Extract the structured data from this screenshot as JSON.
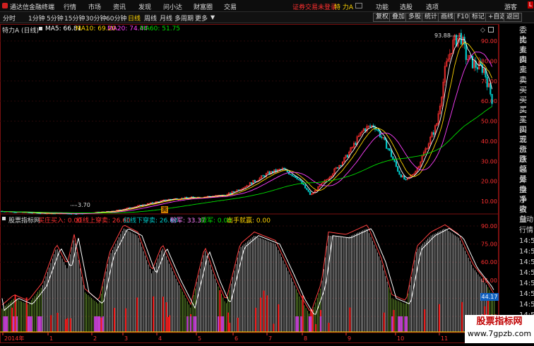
{
  "titlebar": {
    "app_title": "通达信金融终端",
    "menus": [
      "行情",
      "市场",
      "资讯",
      "发现",
      "问小达",
      "财富圈",
      "交易"
    ],
    "login_warning": "证券交易未登录",
    "stock_name": "特 力A",
    "right_menus": [
      "功能",
      "选股",
      "选项",
      "游客"
    ]
  },
  "toolbar": {
    "periods": [
      "分时",
      "1分钟",
      "5分钟",
      "15分钟",
      "30分钟",
      "60分钟",
      "日线",
      "周线",
      "月线",
      "多周期",
      "更多"
    ],
    "active_period": "日线",
    "buttons": [
      "复权",
      "叠加",
      "多股",
      "统计",
      "画线",
      "F10",
      "标记",
      "+自选",
      "返回"
    ]
  },
  "main_chart": {
    "stock_label": "特力A (日线)",
    "ma5": "MA5: 66.81",
    "ma10": "MA10: 69.20",
    "ma20": "MA20: 74.44",
    "ma60": "MA60: 51.75",
    "high_label": "93.88",
    "low_label": "3.70",
    "y_ticks": [
      "90.00",
      "80.00",
      "70.00",
      "60.00",
      "50.00",
      "40.00",
      "30.00",
      "20.00",
      "10.00"
    ],
    "marker_char": "寅",
    "colors": {
      "up": "#ff3030",
      "down": "#00c8c8",
      "ma5": "#ffffff",
      "ma10": "#ffd400",
      "ma20": "#ff40ff",
      "ma60": "#00e000"
    }
  },
  "indicator": {
    "name": "股票指标网",
    "label1": "买庄买入: 0.00",
    "label2": "红线上穿卖: 26.60",
    "label3": "红线下穿卖: 26.60",
    "label4": "粉军: 33.37",
    "label5": "绿军: 0.00",
    "label6": "出手就赢: 0.00",
    "y_ticks": [
      "90.00",
      "75.00",
      "60.00",
      "45.00",
      "30.00",
      "15.00"
    ],
    "current_value": "44.17"
  },
  "x_axis": {
    "labels": [
      "2014年",
      "1",
      "2",
      "3",
      "4",
      "5",
      "6",
      "7",
      "8",
      "9",
      "10",
      "11"
    ]
  },
  "right_panel": {
    "items": [
      "委比",
      "卖五",
      "卖四",
      "卖三",
      "卖二",
      "卖一",
      "买一",
      "买二",
      "买三",
      "买四",
      "买五",
      "现价",
      "涨跌",
      "涨幅",
      "总量",
      "外盘",
      "换手",
      "净资",
      "收益"
    ],
    "items2": [
      "自动",
      "行情",
      "14:5",
      "14:5",
      "14:5",
      "14:5",
      "14:5",
      "14:5",
      "14:5",
      "14:5",
      "14:5"
    ],
    "badge": "L"
  },
  "watermark": {
    "title": "股票指标网",
    "url": "www.7gpzb.com"
  }
}
